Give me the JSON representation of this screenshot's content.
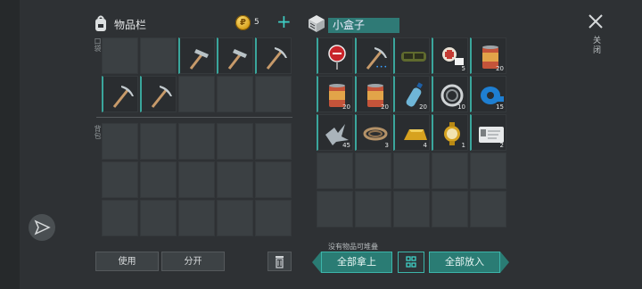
{
  "inventory": {
    "title": "物品栏",
    "coins": "5",
    "pocket_label": "口袋",
    "backpack_label": "背包",
    "use_label": "使用",
    "split_label": "分开"
  },
  "container": {
    "title": "小盒子",
    "close_label": "关闭",
    "no_stack_note": "没有物品可堆叠",
    "take_all_label": "全部拿上",
    "put_all_label": "全部放入"
  },
  "pocket_slots": [
    {
      "item": "empty"
    },
    {
      "item": "empty"
    },
    {
      "item": "hammer-icon"
    },
    {
      "item": "hammer-icon"
    },
    {
      "item": "pickaxe-icon"
    },
    {
      "item": "pickaxe-icon"
    },
    {
      "item": "pickaxe-icon"
    },
    {
      "item": "empty"
    },
    {
      "item": "empty"
    },
    {
      "item": "empty"
    }
  ],
  "container_slots": [
    {
      "item": "stop-sign-icon",
      "count": ""
    },
    {
      "item": "pickaxe-icon",
      "count": "",
      "dots": "•••"
    },
    {
      "item": "goggles-icon",
      "count": ""
    },
    {
      "item": "medkit-icon",
      "count": "5"
    },
    {
      "item": "canned-food-icon",
      "count": "20"
    },
    {
      "item": "canned-food-icon",
      "count": "20"
    },
    {
      "item": "canned-food-icon",
      "count": "20"
    },
    {
      "item": "water-bottle-icon",
      "count": "20"
    },
    {
      "item": "bearing-ring-icon",
      "count": "10"
    },
    {
      "item": "duct-tape-icon",
      "count": "15"
    },
    {
      "item": "metal-scrap-icon",
      "count": "45"
    },
    {
      "item": "rope-icon",
      "count": "3"
    },
    {
      "item": "gold-bar-icon",
      "count": "4"
    },
    {
      "item": "gold-watch-icon",
      "count": "1"
    },
    {
      "item": "id-card-icon",
      "count": "2"
    }
  ],
  "colors": {
    "accent": "#3fd0c6",
    "teal_button": "#2a7c74",
    "slot_bg": "#3b4043",
    "bg": "#2e3134"
  }
}
